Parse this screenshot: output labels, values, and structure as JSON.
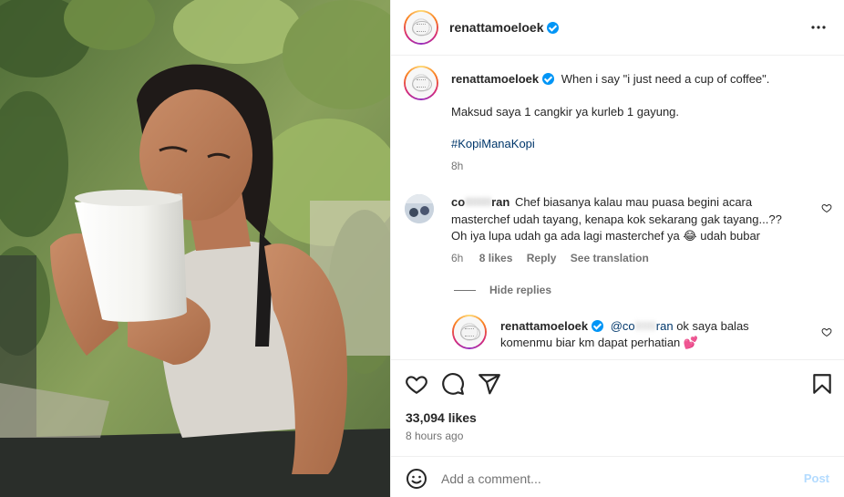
{
  "header": {
    "username": "renattamoeloek",
    "more_icon": "more-horizontal-icon"
  },
  "caption": {
    "username": "renattamoeloek",
    "line1": "When i say \"i just need a cup of coffee\".",
    "line2": "Maksud saya 1 cangkir ya kurleb 1 gayung.",
    "hashtag": "#KopiManaKopi",
    "time": "8h"
  },
  "comment": {
    "username_visible_start": "co",
    "username_blurred": "[blurred]",
    "username_visible_end": "ran",
    "text_line1": "Chef biasanya kalau mau puasa begini acara",
    "text_line2": "masterchef udah tayang, kenapa kok sekarang gak tayang...??",
    "text_line3a": "Oh iya lupa udah ga ada lagi masterchef ya",
    "emoji": "😂",
    "text_line3b": "udah bubar",
    "time": "6h",
    "likes": "8 likes",
    "reply_label": "Reply",
    "translation_label": "See translation"
  },
  "hide_replies_label": "Hide replies",
  "reply": {
    "username": "renattamoeloek",
    "mention_start": "@co",
    "mention_blurred": "[blurred]",
    "mention_end": "ran",
    "text_a": "ok saya balas",
    "text_line2": "komenmu biar km dapat perhatian",
    "emoji": "💕"
  },
  "actions": {
    "like_icon": "heart-icon",
    "comment_icon": "comment-icon",
    "share_icon": "send-icon",
    "save_icon": "bookmark-icon"
  },
  "likes": "33,094 likes",
  "posted_ago": "8 hours ago",
  "add_comment": {
    "placeholder": "Add a comment...",
    "post_label": "Post",
    "emoji_icon": "emoji-smiley-icon"
  },
  "colors": {
    "link": "#00376b",
    "verified": "#0095f6",
    "meta": "#737373",
    "post_disabled": "#b3dbff"
  }
}
